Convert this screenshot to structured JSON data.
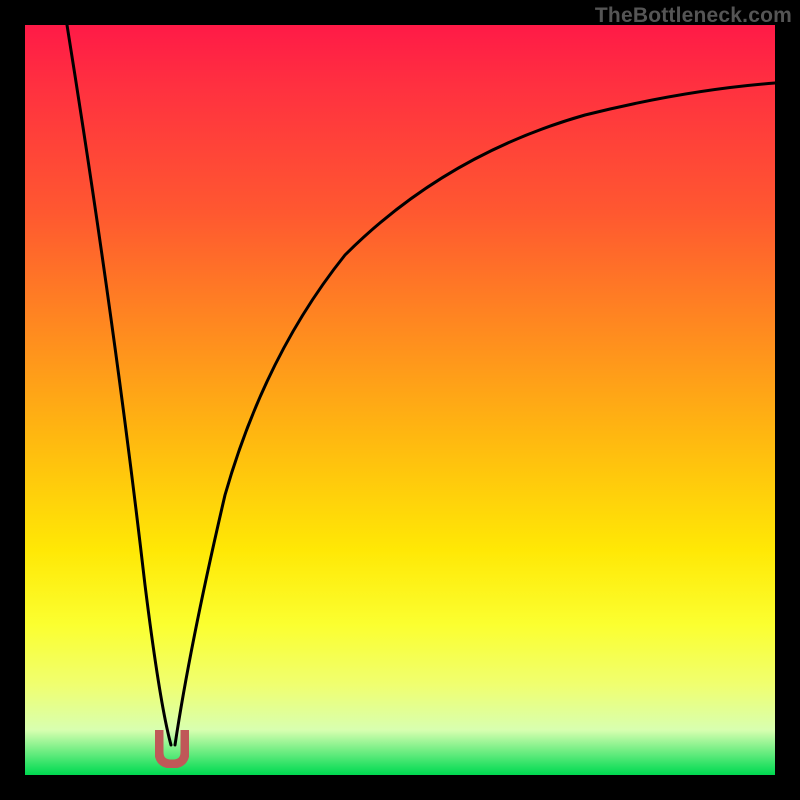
{
  "attribution": "TheBottleneck.com",
  "colors": {
    "frame": "#000000",
    "gradient_top": "#ff1a47",
    "gradient_mid": "#ffe805",
    "gradient_bottom": "#00d850",
    "curve": "#000000",
    "min_marker": "#c05858"
  },
  "chart_data": {
    "type": "line",
    "title": "",
    "xlabel": "",
    "ylabel": "",
    "xlim": [
      0,
      100
    ],
    "ylim": [
      0,
      100
    ],
    "series": [
      {
        "name": "bottleneck-curve",
        "x": [
          0,
          5,
          10,
          15,
          18,
          19,
          20,
          21,
          22,
          25,
          30,
          35,
          40,
          50,
          60,
          70,
          80,
          90,
          100
        ],
        "values": [
          100,
          76,
          50,
          20,
          5,
          1,
          0,
          1,
          5,
          20,
          40,
          53,
          62,
          73,
          80,
          84,
          87,
          89,
          90
        ]
      }
    ],
    "annotations": [
      {
        "name": "min-marker",
        "x": 20,
        "y": 2,
        "shape": "u"
      }
    ]
  }
}
